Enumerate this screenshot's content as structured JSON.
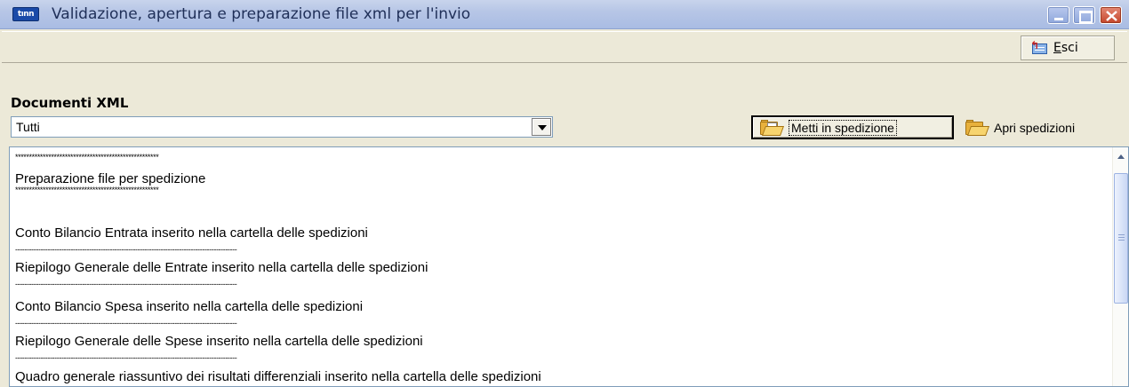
{
  "window": {
    "title": "Validazione, apertura e preparazione file xml per l'invio",
    "app_icon_text": "tınn",
    "controls": [
      "minimize-icon",
      "maximize-icon",
      "close-icon"
    ]
  },
  "toolbar": {
    "esci_label_first": "E",
    "esci_label_rest": "sci",
    "esci_icon": "exit-icon"
  },
  "section": {
    "label": "Documenti XML"
  },
  "filter": {
    "selected": "Tutti"
  },
  "actions": {
    "metti_label": "Metti in spedizione",
    "apri_label": "Apri spedizioni",
    "icon": "folder-icon"
  },
  "log": {
    "stars": "****************************************************",
    "heading": "Preparazione file per spedizione",
    "dashes": "------------------------------------------------------------------------------------------------",
    "lines": [
      "Conto Bilancio Entrata inserito nella cartella delle spedizioni",
      "Riepilogo Generale delle Entrate inserito nella cartella delle spedizioni",
      "Conto Bilancio Spesa inserito nella cartella delle spedizioni",
      "Riepilogo Generale delle Spese inserito nella cartella delle spedizioni",
      "Quadro generale riassuntivo dei risultati differenziali inserito nella cartella delle spedizioni"
    ]
  }
}
